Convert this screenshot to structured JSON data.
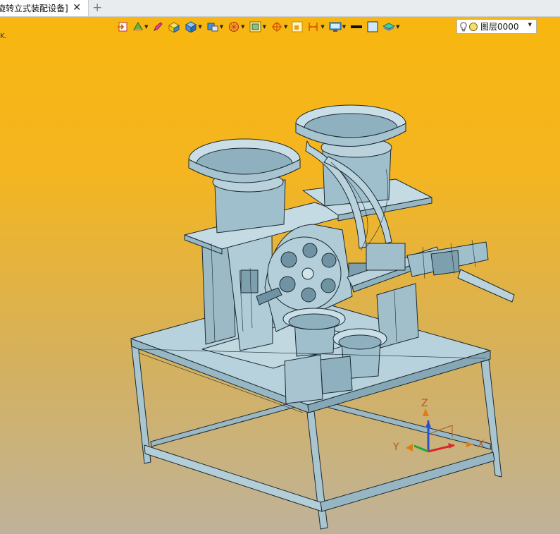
{
  "tab": {
    "title": "旋转立式装配设备]",
    "close_label": "✕",
    "add_label": "+"
  },
  "viewport": {
    "corner_mark": "K."
  },
  "toolbar": {
    "layer_label": "图层0000",
    "icons": [
      "import-icon",
      "tools-icon",
      "pencil-icon",
      "solid-box-icon",
      "cube-icon",
      "shape-icon",
      "wheel-icon",
      "frame-icon",
      "target-icon",
      "panel-icon",
      "dimension-icon",
      "display-icon",
      "color-swatch-icon",
      "fill-swatch-icon",
      "layers-icon"
    ]
  },
  "triad": {
    "x_label": "X",
    "y_label": "Y",
    "z_label": "Z"
  },
  "colors": {
    "bg_top": "#f8b60f",
    "bg_bottom": "#bfb29a",
    "model_fill": "#a9c7d3",
    "model_edge": "#1a2a33"
  }
}
